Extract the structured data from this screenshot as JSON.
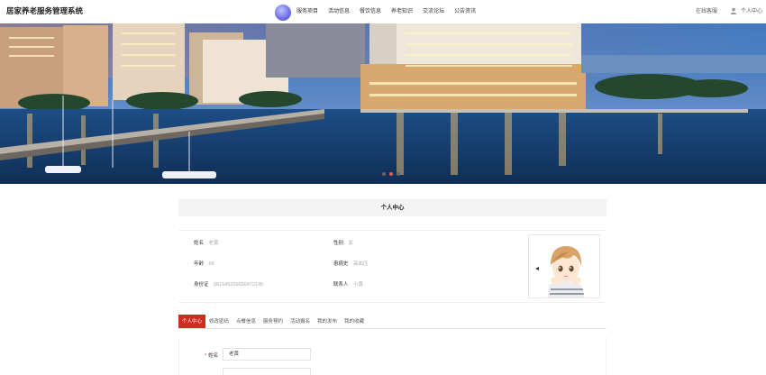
{
  "header": {
    "site_title": "居家养老服务管理系统",
    "nav": [
      "服务项目",
      "活动信息",
      "餐饮信息",
      "养老知识",
      "交流论坛",
      "公告资讯"
    ],
    "online_consult": "在线客服",
    "user_center": "个人中心"
  },
  "banner": {
    "slides_count": 3,
    "active_slide": 2
  },
  "section_title": "个人中心",
  "profile": {
    "name_label": "姓名",
    "name_value": "老黄",
    "gender_label": "性别",
    "gender_value": "女",
    "age_label": "年龄",
    "age_value": "68",
    "history_label": "患病史",
    "history_value": "高血压",
    "id_label": "身份证",
    "id_value": "661545259656472145",
    "contact_label": "联系人",
    "contact_value": "小黄"
  },
  "tabs": [
    "个人中心",
    "修改密码",
    "点餐信息",
    "服务预约",
    "活动报名",
    "我的发布",
    "我的收藏"
  ],
  "active_tab": 0,
  "form": {
    "name_label": "姓名",
    "name_value": "老黄"
  },
  "colors": {
    "accent": "#d22b20",
    "active_dot": "#e6584a",
    "header_bg": "#f3f3f3"
  }
}
